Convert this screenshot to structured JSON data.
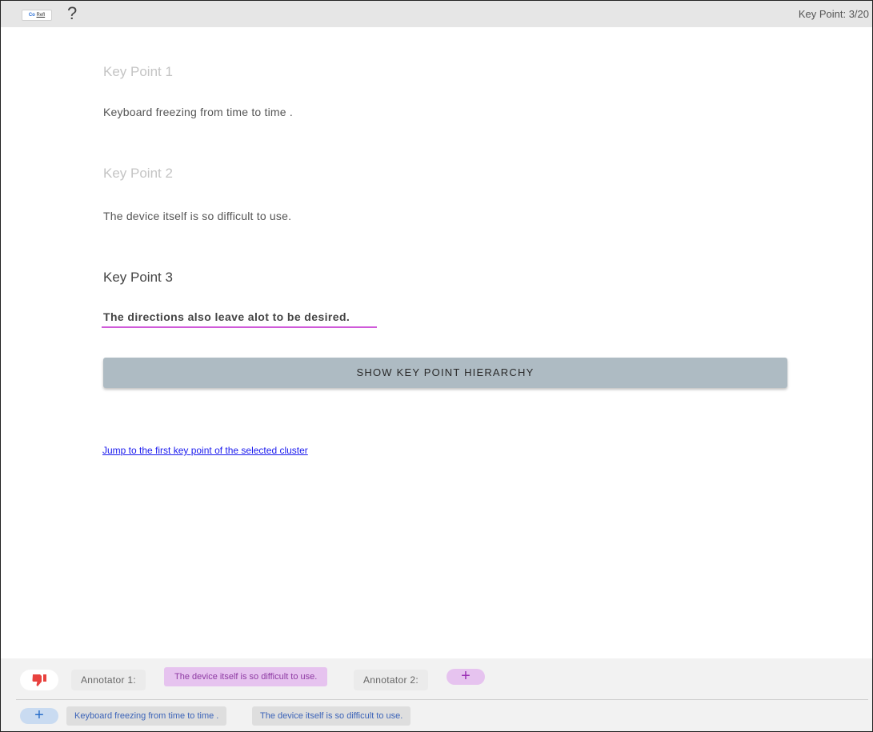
{
  "header": {
    "logo_left": "Co",
    "logo_right": "Refl",
    "help_label": "?",
    "key_point_counter": "Key Point: 3/20"
  },
  "key_points": [
    {
      "title": "Key Point 1",
      "text": "Keyboard freezing from time to time ."
    },
    {
      "title": "Key Point 2",
      "text": "The device itself is so difficult to use."
    },
    {
      "title": "Key Point 3",
      "text": "The directions also leave alot to be desired."
    }
  ],
  "hierarchy_button_label": "SHOW KEY POINT HIERARCHY",
  "jump_link": "Jump to the first key point of the selected cluster",
  "annotations": {
    "annotator1_label": "Annotator 1:",
    "annotator1_chip": "The device itself is so difficult to use.",
    "annotator2_label": "Annotator 2:",
    "add_symbol": "+"
  },
  "options": [
    "Keyboard freezing from time to time .",
    "The device itself is so difficult to use."
  ],
  "colors": {
    "accent_purple": "#cf5ad9",
    "dislike_red": "#e8423f",
    "button_gray": "#aebbc3"
  }
}
